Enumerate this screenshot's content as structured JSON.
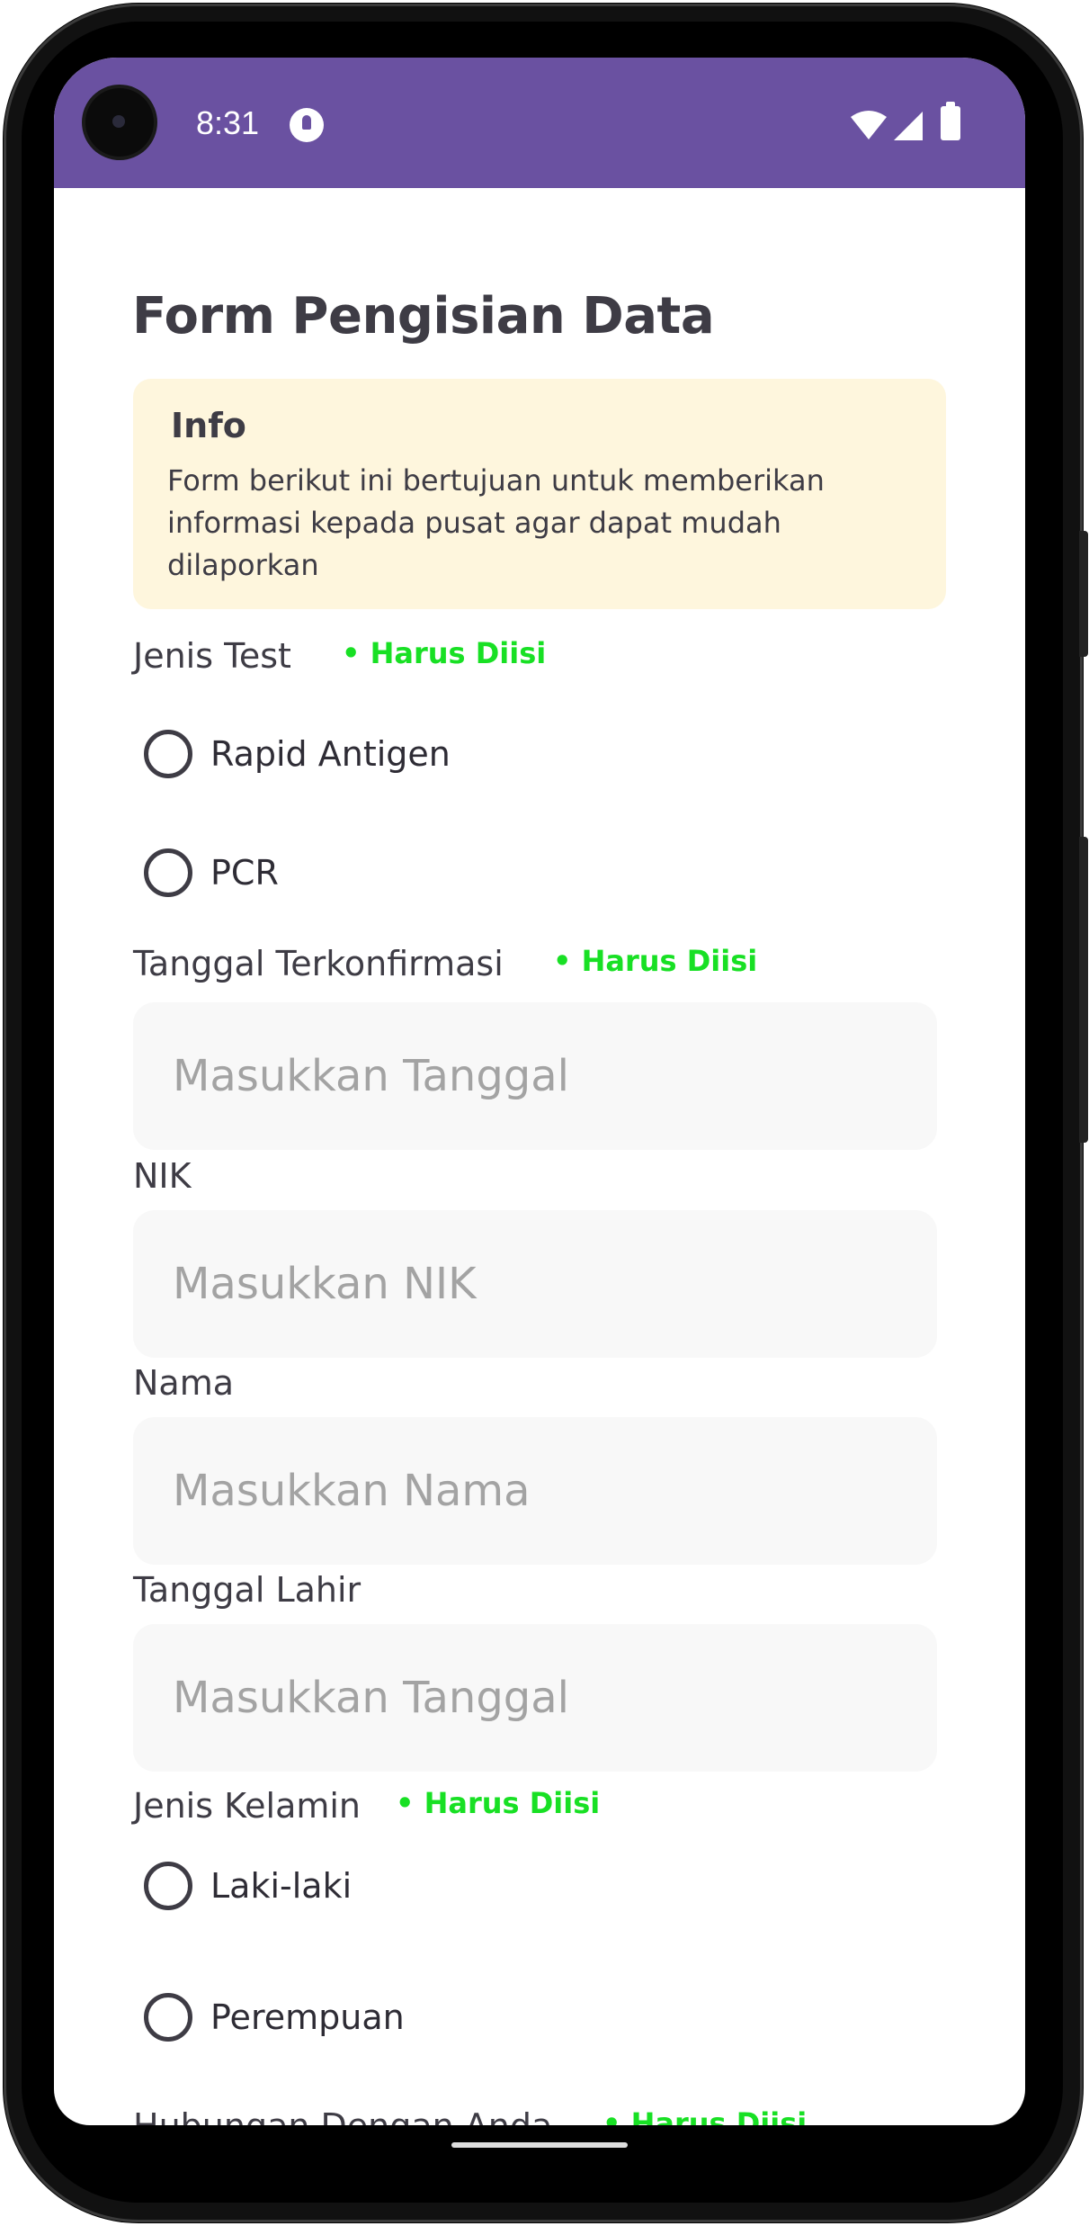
{
  "status_bar": {
    "time": "8:31",
    "icons": [
      "camera-icon",
      "app-notification-icon",
      "wifi-icon",
      "signal-icon",
      "battery-icon"
    ],
    "color": "#6a51a1"
  },
  "form": {
    "title": "Form Pengisian Data",
    "info": {
      "title": "Info",
      "text": "Form berikut ini bertujuan untuk memberikan informasi kepada pusat agar dapat mudah dilaporkan"
    },
    "required_label": "• Harus Diisi",
    "jenis_test": {
      "label": "Jenis Test",
      "options": [
        "Rapid Antigen",
        "PCR"
      ]
    },
    "tanggal_terkonfirmasi": {
      "label": "Tanggal Terkonfirmasi",
      "placeholder": "Masukkan Tanggal"
    },
    "nik": {
      "label": "NIK",
      "placeholder": "Masukkan NIK"
    },
    "nama": {
      "label": "Nama",
      "placeholder": "Masukkan Nama"
    },
    "tanggal_lahir": {
      "label": "Tanggal Lahir",
      "placeholder": "Masukkan Tanggal"
    },
    "jenis_kelamin": {
      "label": "Jenis Kelamin",
      "options": [
        "Laki-laki",
        "Perempuan"
      ]
    },
    "hubungan": {
      "label": "Hubungan Dengan Anda"
    }
  },
  "colors": {
    "primary": "#6a51a1",
    "required": "#18e024",
    "info_bg": "#fef6dd",
    "text": "#3e3c45",
    "input_bg": "#f8f8f8",
    "placeholder": "#a3a3a3"
  }
}
